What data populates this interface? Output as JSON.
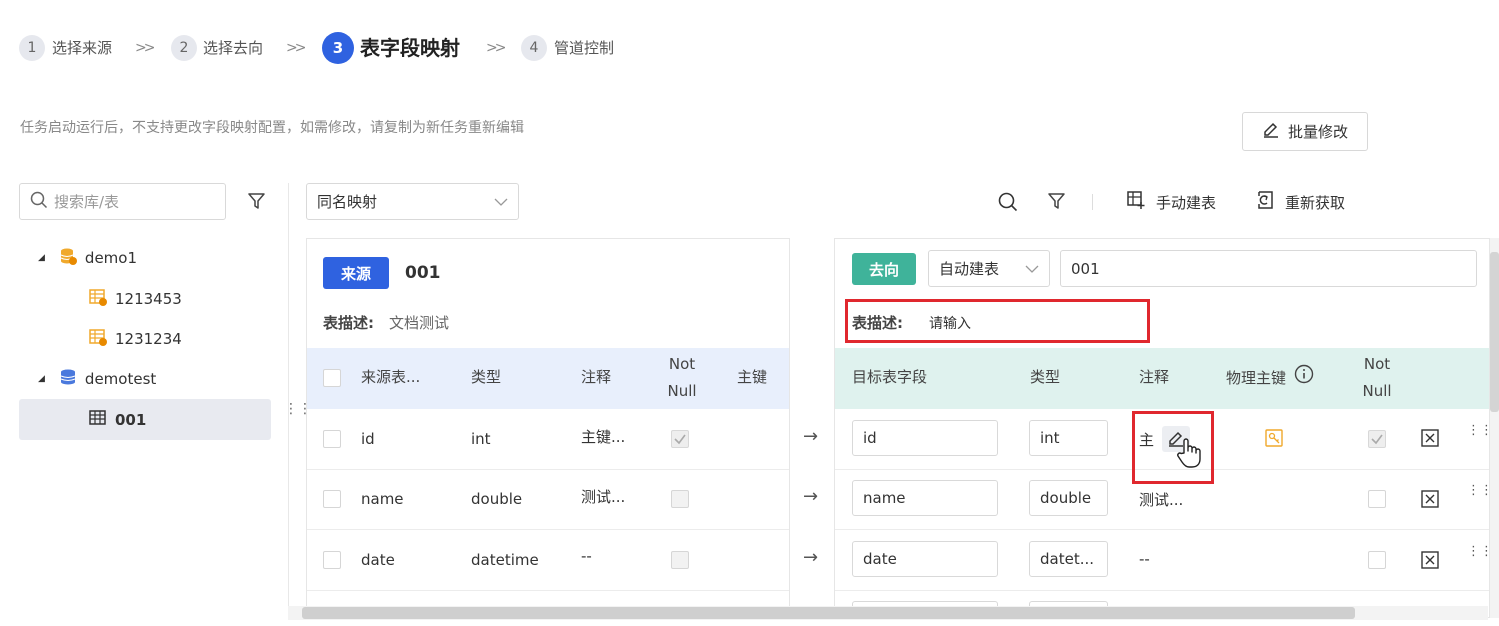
{
  "steps": [
    {
      "num": "1",
      "label": "选择来源"
    },
    {
      "num": "2",
      "label": "选择去向"
    },
    {
      "num": "3",
      "label": "表字段映射"
    },
    {
      "num": "4",
      "label": "管道控制"
    }
  ],
  "hint": "任务启动运行后，不支持更改字段映射配置，如需修改，请复制为新任务重新编辑",
  "batch_edit_label": "批量修改",
  "search_placeholder": "搜索库/表",
  "mapping_select": "同名映射",
  "manual_create_label": "手动建表",
  "refetch_label": "重新获取",
  "tree": {
    "db1": "demo1",
    "db1_tables": [
      "1213453",
      "1231234"
    ],
    "db2": "demotest",
    "db2_tables": [
      "001"
    ]
  },
  "source": {
    "tag": "来源",
    "table_name": "001",
    "desc_label": "表描述:",
    "desc_value": "文档测试",
    "headers": {
      "field": "来源表...",
      "type": "类型",
      "comment": "注释",
      "notnull_1": "Not",
      "notnull_2": "Null",
      "pk": "主键"
    },
    "rows": [
      {
        "field": "id",
        "type": "int",
        "comment": "主键..."
      },
      {
        "field": "name",
        "type": "double",
        "comment": "测试..."
      },
      {
        "field": "date",
        "type": "datetime",
        "comment": "--"
      }
    ]
  },
  "target": {
    "tag": "去向",
    "create_mode": "自动建表",
    "table_name": "001",
    "desc_label": "表描述:",
    "desc_placeholder": "请输入",
    "headers": {
      "field": "目标表字段",
      "type": "类型",
      "comment": "注释",
      "pk": "物理主键",
      "notnull_1": "Not",
      "notnull_2": "Null"
    },
    "rows": [
      {
        "field": "id",
        "type": "int",
        "comment": "主"
      },
      {
        "field": "name",
        "type": "double",
        "comment": "测试..."
      },
      {
        "field": "date",
        "type": "datet...",
        "comment": "--"
      }
    ]
  },
  "colors": {
    "primary": "#2f62e0",
    "target_tag": "#3fb39a",
    "source_header_bg": "#e8effc",
    "target_header_bg": "#dff2ee",
    "highlight": "#e0282e"
  }
}
